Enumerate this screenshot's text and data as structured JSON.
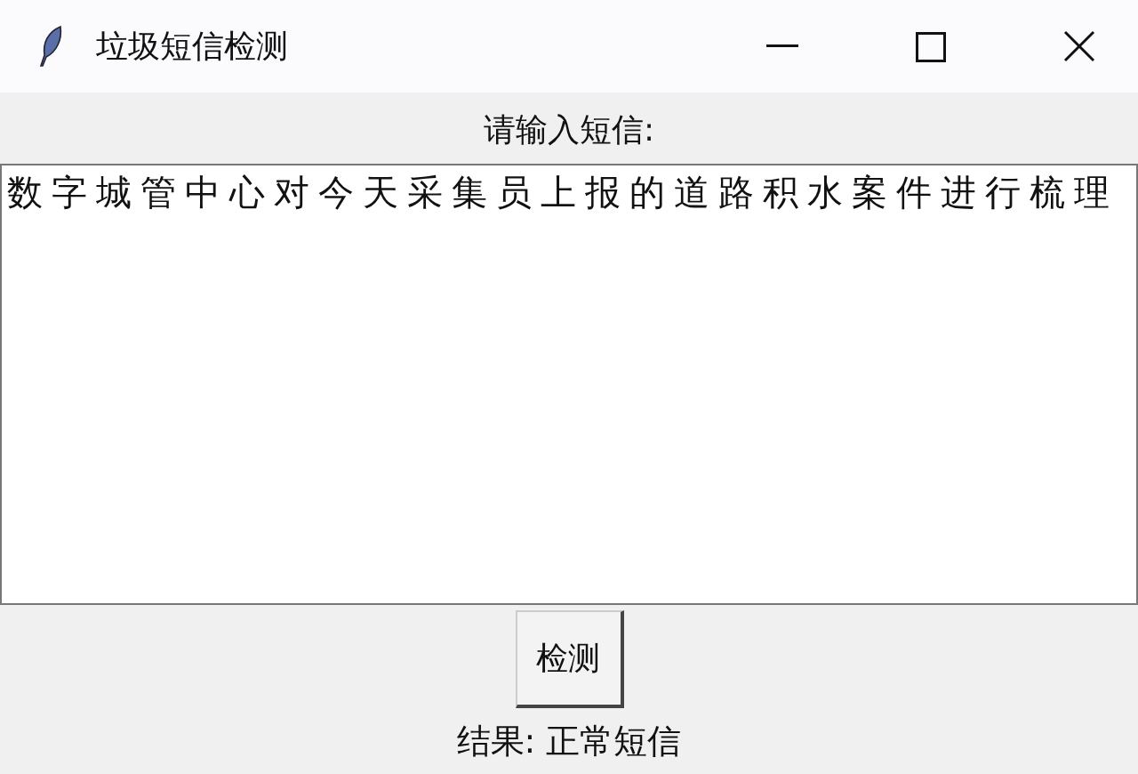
{
  "window": {
    "title": "垃圾短信检测"
  },
  "prompt_label": "请输入短信:",
  "message_field": {
    "value": "数字城管中心对今天采集员上报的道路积水案件进行梳理"
  },
  "detect_button": {
    "label": "检测"
  },
  "result_label": "结果: 正常短信"
}
